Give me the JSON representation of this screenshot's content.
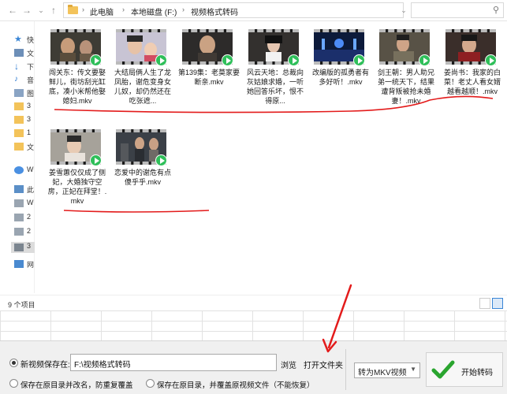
{
  "address": {
    "breadcrumbs": [
      "此电脑",
      "本地磁盘 (F:)",
      "视频格式转码"
    ]
  },
  "navpane": {
    "items": [
      "快",
      "文",
      "下",
      "音",
      "图",
      "3",
      "3",
      "1",
      "文",
      "W",
      "此",
      "W",
      "2",
      "2",
      "3",
      "网"
    ]
  },
  "files": [
    "闯关东：传文要娶鲜儿，街坊刮光缸底，凑小米帮他娶媳妇.mkv",
    "大结局俩人生了龙凤胎，谢危变身女儿奴，却仍然还在吃张遮...",
    "第139集：老莫家要断亲.mkv",
    "风云天地：总裁向灰姑娘求婚，一听她回答乐坏，恨不得原...",
    "改编版的孤勇者有多好听！.mkv",
    "剑王朝：男人助兄弟一统天下，结果遭背叛被抢未婚妻！.mkv",
    "姜尚书：我家的白菜！老丈人看女婿越看越顺！.mkv",
    "姜雪蕙仅仅成了侧妃，大婚独守空房，正妃在拜堂！.mkv",
    "恋爱中的谢危有点傻乎乎.mkv"
  ],
  "status": {
    "count": "9 个项目"
  },
  "bottom": {
    "save_label": "新视频保存在:",
    "save_path": "F:\\视频格式转码",
    "browse": "浏览",
    "open_folder": "打开文件夹",
    "opt_keep_rename": "保存在原目录并改名，防重复覆盖",
    "opt_overwrite": "保存在原目录，并覆盖原视频文件（不能恢复）",
    "convert_select": "转为MKV视频",
    "start": "开始转码"
  },
  "colors": {
    "annotation_red": "#e31b1b",
    "selection_green": "#2fbf5a",
    "folder_yellow": "#f3c35a",
    "accent_blue": "#3a86d6"
  }
}
